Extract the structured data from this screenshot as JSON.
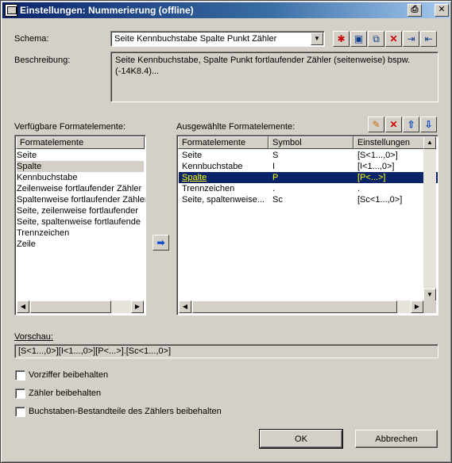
{
  "window": {
    "title": "Einstellungen: Nummerierung (offline)"
  },
  "schema": {
    "label": "Schema:",
    "value": "Seite Kennbuchstabe Spalte Punkt Zähler"
  },
  "description": {
    "label": "Beschreibung:",
    "text": "Seite Kennbuchstabe, Spalte Punkt fortlaufender Zähler (seitenweise) bspw. (-14K8.4)..."
  },
  "available": {
    "label": "Verfügbare Formatelemente:",
    "column": "Formatelemente",
    "items": [
      "Seite",
      "Spalte",
      "Kennbuchstabe",
      "Zeilenweise fortlaufender Zähler",
      "Spaltenweise fortlaufender Zähler",
      "Seite, zeilenweise fortlaufender",
      "Seite, spaltenweise fortlaufende",
      "Trennzeichen",
      "Zeile"
    ],
    "selected_index": 1
  },
  "selected": {
    "label": "Ausgewählte Formatelemente:",
    "columns": [
      "Formatelemente",
      "Symbol",
      "Einstellungen"
    ],
    "rows": [
      [
        "Seite",
        "S",
        "[S<1...,0>]"
      ],
      [
        "Kennbuchstabe",
        "I",
        "[I<1...,0>]"
      ],
      [
        "Spalte",
        "P",
        "[P<...>]"
      ],
      [
        "Trennzeichen",
        ".",
        "."
      ],
      [
        "Seite, spaltenweise...",
        "Sc",
        "[Sc<1...,0>]"
      ]
    ],
    "selected_index": 2
  },
  "preview": {
    "label": "Vorschau:",
    "text": "[S<1...,0>][I<1...,0>][P<...>].[Sc<1...,0>]"
  },
  "options": [
    "Vorziffer beibehalten",
    "Zähler beibehalten",
    "Buchstaben-Bestandteile des Zählers beibehalten"
  ],
  "buttons": {
    "ok": "OK",
    "cancel": "Abbrechen"
  },
  "colors": {
    "selection": "#0a246a",
    "selection_text": "#ffff00",
    "face": "#d4d0c8"
  }
}
